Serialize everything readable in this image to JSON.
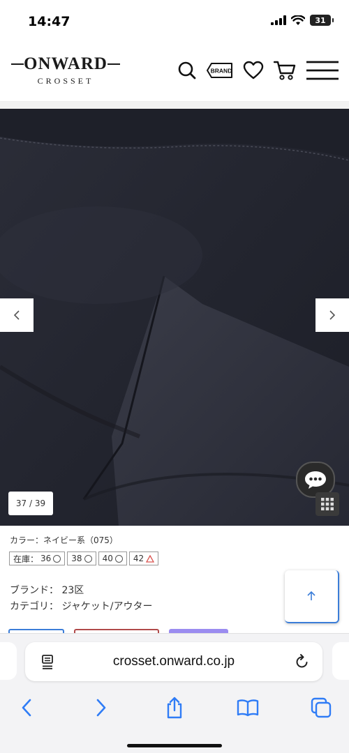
{
  "status": {
    "time": "14:47",
    "battery": "31"
  },
  "header": {
    "logo_main": "ONWARD",
    "logo_sub": "CROSSET",
    "brand_icon_text": "BRAND"
  },
  "gallery": {
    "counter": "37 / 39"
  },
  "product": {
    "color_label": "カラー：ネイビー系（075）",
    "stock_label": "在庫：",
    "sizes": [
      {
        "size": "36",
        "status": "available"
      },
      {
        "size": "38",
        "status": "available"
      },
      {
        "size": "40",
        "status": "available"
      },
      {
        "size": "42",
        "status": "few-left"
      }
    ],
    "brand_line": "ブランド： 23区",
    "category_line": "カテゴリ： ジャケット/アウター"
  },
  "colors": {
    "accent_blue": "#3b7dd8",
    "low_stock_red": "#d9534f",
    "image_bg": "#242630",
    "lavender": "#9b8cf0"
  },
  "browser": {
    "url": "crosset.onward.co.jp"
  }
}
